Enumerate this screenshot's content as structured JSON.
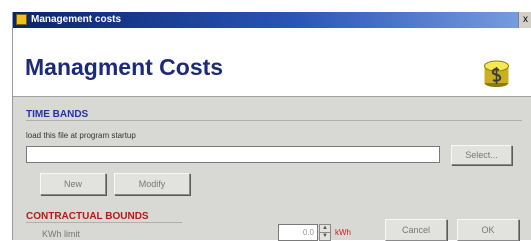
{
  "window": {
    "title": "Management costs",
    "close_glyph": "x"
  },
  "header": {
    "title": "Managment Costs",
    "icon": "dollar-coin-icon"
  },
  "time_bands": {
    "label": "TIME BANDS",
    "hint": "load this file at program startup",
    "file_value": "",
    "select_label": "Select...",
    "new_label": "New",
    "modify_label": "Modify"
  },
  "contractual_bounds": {
    "label": "CONTRACTUAL BOUNDS",
    "kwh_label": "KWh limit",
    "kwh_value": "0.0",
    "unit": "kWh"
  },
  "footer": {
    "cancel_label": "Cancel",
    "ok_label": "OK"
  },
  "colors": {
    "title_blue": "#1d2a78",
    "section_blue": "#2233aa",
    "section_red": "#b81818",
    "panel_gray": "#d8d8d4"
  }
}
